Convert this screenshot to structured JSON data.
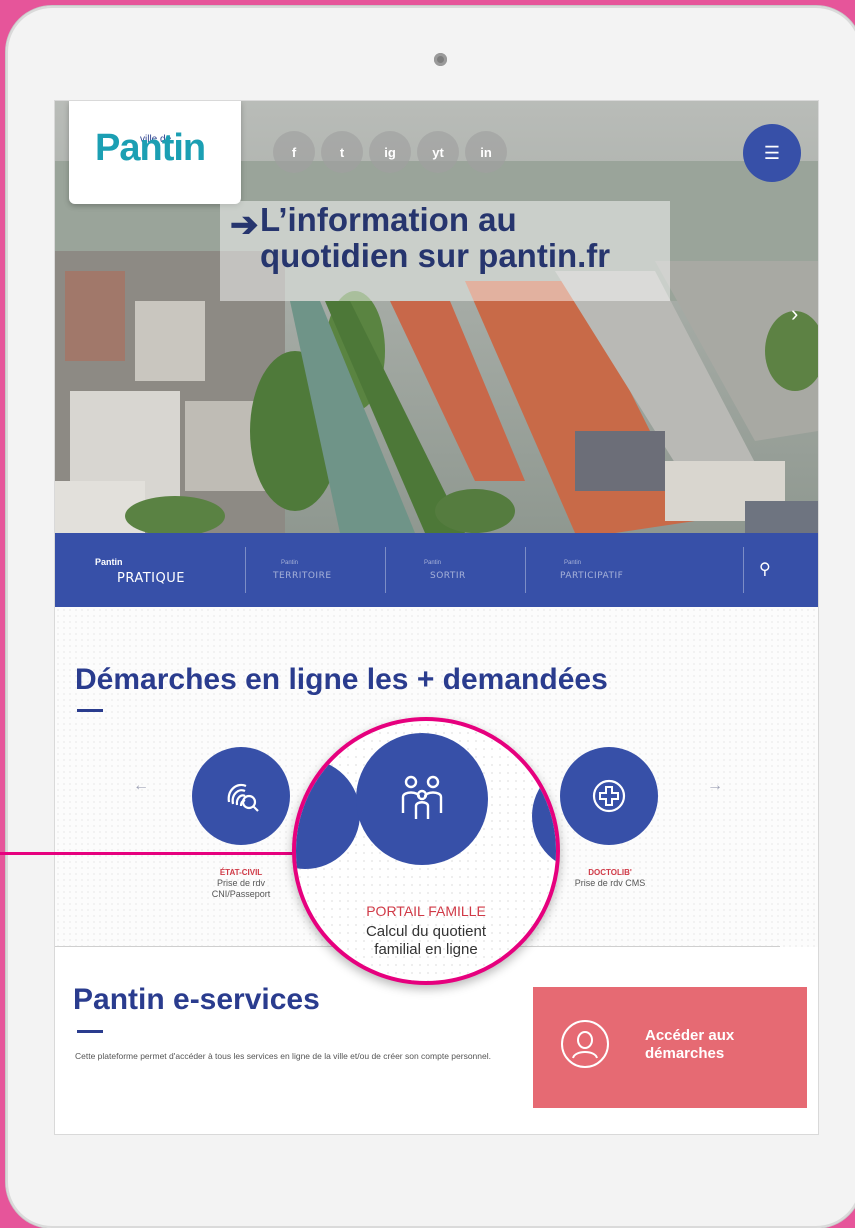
{
  "header": {
    "logo_small": "ville de",
    "logo_main": "Pantin",
    "social": [
      "f",
      "t",
      "ig",
      "yt",
      "in"
    ],
    "headline_line1": "L’information au",
    "headline_line2": "quotidien sur pantin.fr"
  },
  "nav": {
    "items": [
      {
        "small": "Pantin",
        "big": "PRATIQUE"
      },
      {
        "small": "Pantin",
        "big": "TERRITOIRE"
      },
      {
        "small": "Pantin",
        "big": "SORTIR"
      },
      {
        "small": "Pantin",
        "big": "PARTICIPATIF"
      }
    ]
  },
  "demarches": {
    "title": "Démarches en ligne les + demandées",
    "cards": [
      {
        "title": "ÉTAT-CIVIL",
        "line1": "Prise de rdv",
        "line2": "CNI/Passeport"
      },
      {
        "title": "PORTAIL FAMILLE",
        "line1": "Calcul du quotient",
        "line2": "familial en ligne"
      },
      {
        "title": "DOCTOLIB'",
        "line1": "Prise de rdv CMS",
        "line2": ""
      }
    ]
  },
  "eservices": {
    "title": "Pantin e-services",
    "description": "Cette plateforme permet d'accéder à tous les services en ligne de la ville et/ou de créer son compte personnel.",
    "cta_line1": "Accéder aux",
    "cta_line2": "démarches"
  },
  "colors": {
    "brand_blue": "#3750a8",
    "accent_pink": "#e6007e",
    "cta_red": "#e66a73"
  }
}
